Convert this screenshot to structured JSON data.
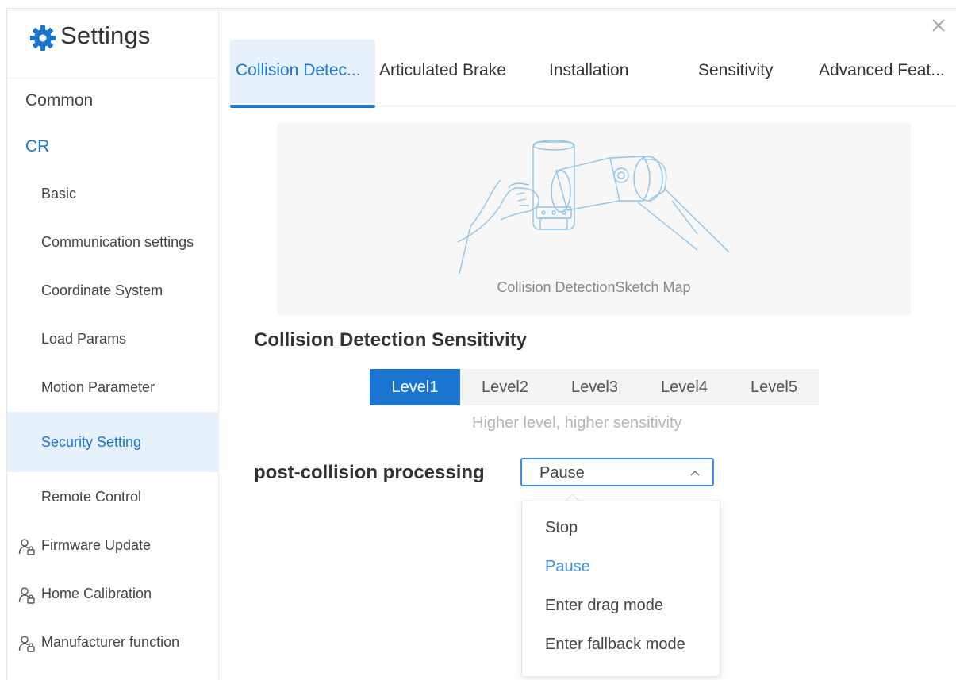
{
  "app": {
    "title": "Settings",
    "icon": "gear-icon",
    "accent_color": "#1b75d0"
  },
  "sidebar": {
    "items": [
      {
        "label": "Common",
        "level": 1
      },
      {
        "label": "CR",
        "level": 1,
        "expanded": true,
        "color": "#1b75d0"
      },
      {
        "label": "Basic",
        "level": 2
      },
      {
        "label": "Communication settings",
        "level": 2
      },
      {
        "label": "Coordinate System",
        "level": 2
      },
      {
        "label": "Load Params",
        "level": 2
      },
      {
        "label": "Motion Parameter",
        "level": 2
      },
      {
        "label": "Security Setting",
        "level": 2,
        "active": true
      },
      {
        "label": "Remote Control",
        "level": 2
      },
      {
        "label": "Firmware Update",
        "level": 1,
        "icon": "user-lock-icon"
      },
      {
        "label": "Home Calibration",
        "level": 1,
        "icon": "user-lock-icon"
      },
      {
        "label": "Manufacturer function",
        "level": 1,
        "icon": "user-lock-icon"
      }
    ]
  },
  "tabs": [
    {
      "label": "Collision Detec...",
      "active": true
    },
    {
      "label": "Articulated Brake"
    },
    {
      "label": "Installation"
    },
    {
      "label": "Sensitivity"
    },
    {
      "label": "Advanced Feat..."
    }
  ],
  "sketch": {
    "caption": "Collision DetectionSketch Map"
  },
  "sensitivity": {
    "title": "Collision Detection Sensitivity",
    "levels": [
      "Level1",
      "Level2",
      "Level3",
      "Level4",
      "Level5"
    ],
    "selected": "Level1",
    "hint": "Higher level, higher sensitivity"
  },
  "post_collision": {
    "label": "post-collision processing",
    "value": "Pause",
    "options": [
      "Stop",
      "Pause",
      "Enter drag mode",
      "Enter fallback mode"
    ],
    "dropdown_open": true
  }
}
